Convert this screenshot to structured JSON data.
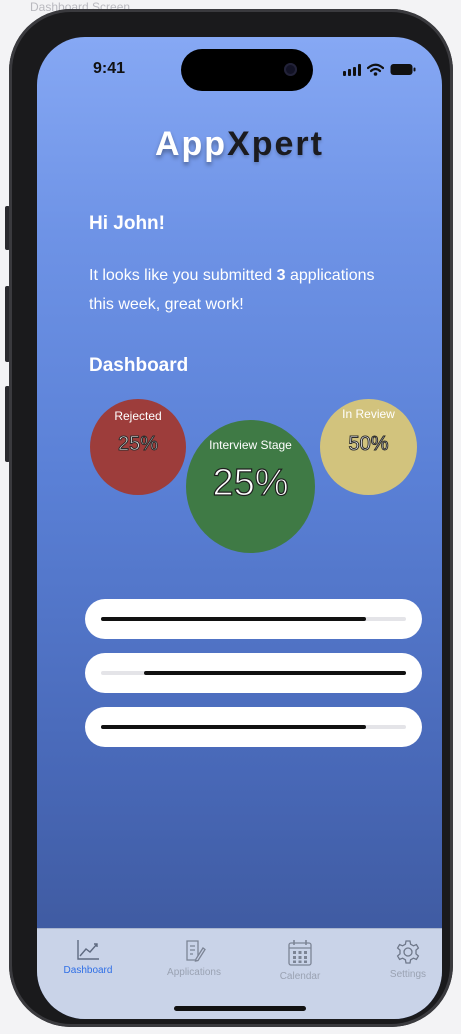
{
  "frame_label": "Dashboard Screen",
  "status_bar": {
    "time": "9:41"
  },
  "app": {
    "title_part1": "App",
    "title_part2": "Xpert"
  },
  "greeting": "Hi John!",
  "message": {
    "prefix": "It looks like you submitted ",
    "count": "3",
    "suffix": " applications this week, great work!"
  },
  "dashboard": {
    "title": "Dashboard",
    "stats": [
      {
        "label": "Rejected",
        "value": "25%",
        "color": "#9d3d3b"
      },
      {
        "label": "Interview Stage",
        "value": "25%",
        "color": "#3f7a45"
      },
      {
        "label": "In Review",
        "value": "50%",
        "color": "#d2c37d"
      }
    ],
    "progress_bars": [
      {
        "start": 0.0,
        "end": 0.87
      },
      {
        "start": 0.14,
        "end": 1.0
      },
      {
        "start": 0.0,
        "end": 0.87
      }
    ]
  },
  "tabbar": {
    "active": "Dashboard",
    "tabs": [
      {
        "label": "Dashboard",
        "icon": "chart-line-icon"
      },
      {
        "label": "Applications",
        "icon": "document-edit-icon"
      },
      {
        "label": "Calendar",
        "icon": "calendar-icon"
      },
      {
        "label": "Settings",
        "icon": "gear-icon"
      }
    ]
  },
  "colors": {
    "accent": "#2f6fe6",
    "gradient_top": "#86a8f4",
    "gradient_bottom": "#3b5496"
  }
}
